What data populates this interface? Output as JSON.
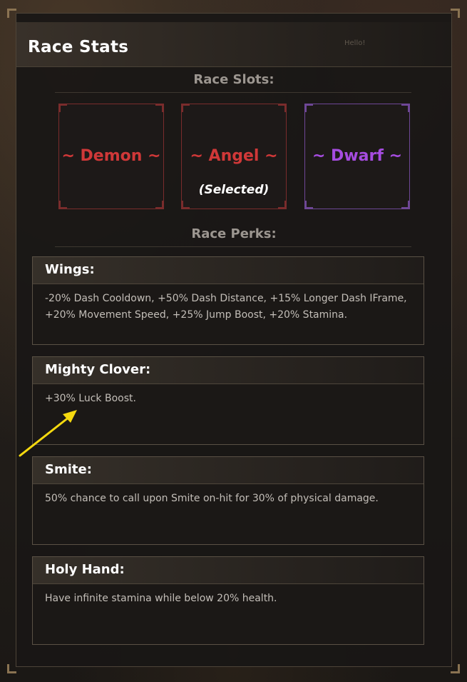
{
  "window": {
    "title": "Race Stats",
    "faint_label": "Hello!"
  },
  "race_slots": {
    "heading": "Race Slots:",
    "slots": [
      {
        "name": "~ Demon ~",
        "color": "#d03838",
        "frame_color": "#7a2c2c",
        "status": ""
      },
      {
        "name": "~ Angel ~",
        "color": "#d03838",
        "frame_color": "#7a2c2c",
        "status": "(Selected)"
      },
      {
        "name": "~ Dwarf ~",
        "color": "#a64ce0",
        "frame_color": "#6e4796",
        "status": ""
      }
    ]
  },
  "race_perks": {
    "heading": "Race Perks:",
    "perks": [
      {
        "title": "Wings:",
        "description": "-20% Dash Cooldown, +50% Dash Distance, +15% Longer Dash IFrame, +20% Movement Speed, +25% Jump Boost, +20% Stamina."
      },
      {
        "title": "Mighty Clover:",
        "description": "+30% Luck Boost."
      },
      {
        "title": "Smite:",
        "description": "50% chance to call upon Smite on-hit for 30% of physical damage."
      },
      {
        "title": "Holy Hand:",
        "description": "Have infinite stamina while below 20% health."
      }
    ]
  },
  "annotation": {
    "arrow_color": "#f5d90f"
  }
}
